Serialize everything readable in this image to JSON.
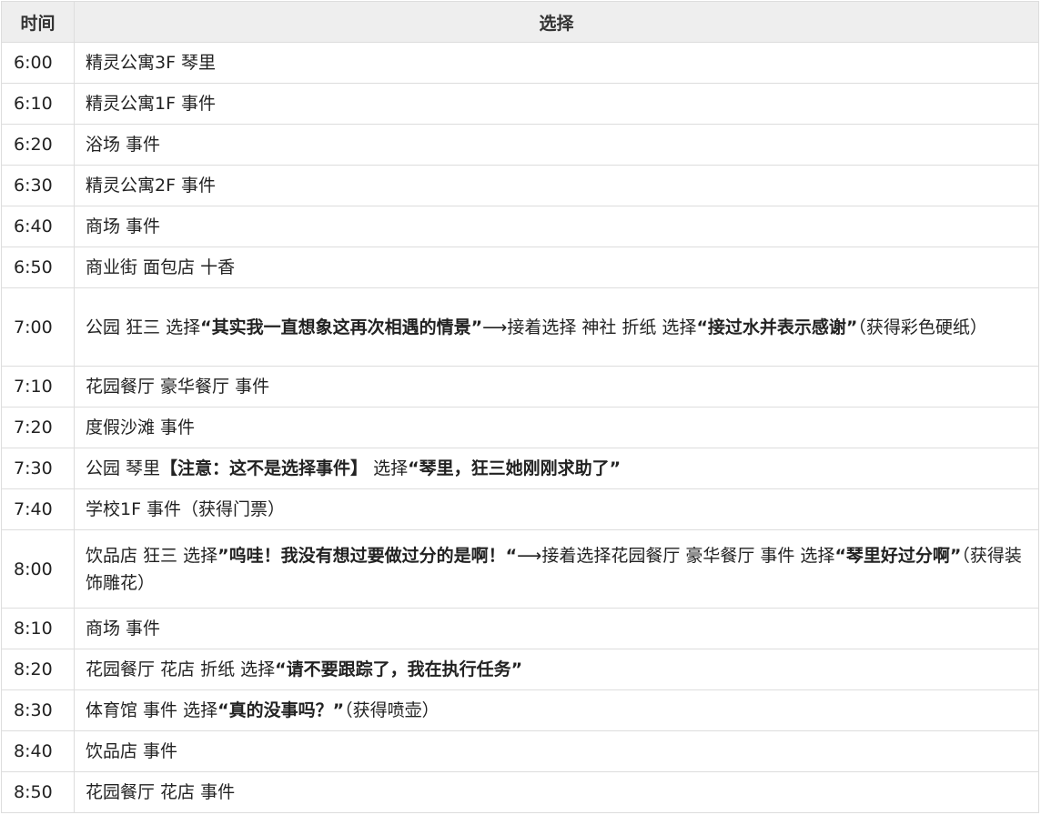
{
  "table": {
    "headers": [
      "时间",
      "选择"
    ],
    "rows": [
      {
        "time": "6:00",
        "segments": [
          {
            "t": "精灵公寓3F 琴里",
            "b": false
          }
        ]
      },
      {
        "time": "6:10",
        "segments": [
          {
            "t": "精灵公寓1F 事件",
            "b": false
          }
        ]
      },
      {
        "time": "6:20",
        "segments": [
          {
            "t": "浴场 事件",
            "b": false
          }
        ]
      },
      {
        "time": "6:30",
        "segments": [
          {
            "t": "精灵公寓2F 事件",
            "b": false
          }
        ]
      },
      {
        "time": "6:40",
        "segments": [
          {
            "t": "商场 事件",
            "b": false
          }
        ]
      },
      {
        "time": "6:50",
        "segments": [
          {
            "t": "商业街 面包店 十香",
            "b": false
          }
        ]
      },
      {
        "time": "7:00",
        "segments": [
          {
            "t": "公园 狂三 选择",
            "b": false
          },
          {
            "t": "“其实我一直想象这再次相遇的情景”",
            "b": true
          },
          {
            "t": "⟶接着选择 神社 折纸 选择",
            "b": false
          },
          {
            "t": "“接过水并表示感谢”",
            "b": true
          },
          {
            "t": "（获得彩色硬纸）",
            "b": false
          }
        ]
      },
      {
        "time": "7:10",
        "segments": [
          {
            "t": "花园餐厅 豪华餐厅 事件",
            "b": false
          }
        ]
      },
      {
        "time": "7:20",
        "segments": [
          {
            "t": "度假沙滩 事件",
            "b": false
          }
        ]
      },
      {
        "time": "7:30",
        "segments": [
          {
            "t": "公园 琴里",
            "b": false
          },
          {
            "t": "【注意：这不是选择事件】",
            "b": true
          },
          {
            "t": " 选择",
            "b": false
          },
          {
            "t": "“琴里，狂三她刚刚求助了”",
            "b": true
          }
        ]
      },
      {
        "time": "7:40",
        "segments": [
          {
            "t": "学校1F 事件（获得门票）",
            "b": false
          }
        ]
      },
      {
        "time": "8:00",
        "segments": [
          {
            "t": "饮品店 狂三 选择",
            "b": false
          },
          {
            "t": "”呜哇！我没有想过要做过分的是啊！“",
            "b": true
          },
          {
            "t": "⟶接着选择花园餐厅 豪华餐厅 事件 选择",
            "b": false
          },
          {
            "t": "“琴里好过分啊”",
            "b": true
          },
          {
            "t": "（获得装饰雕花）",
            "b": false
          }
        ]
      },
      {
        "time": "8:10",
        "segments": [
          {
            "t": "商场 事件",
            "b": false
          }
        ]
      },
      {
        "time": "8:20",
        "segments": [
          {
            "t": "花园餐厅 花店 折纸 选择",
            "b": false
          },
          {
            "t": "“请不要跟踪了，我在执行任务”",
            "b": true
          }
        ]
      },
      {
        "time": "8:30",
        "segments": [
          {
            "t": "体育馆 事件 选择",
            "b": false
          },
          {
            "t": "“真的没事吗？”",
            "b": true
          },
          {
            "t": "（获得喷壶）",
            "b": false
          }
        ]
      },
      {
        "time": "8:40",
        "segments": [
          {
            "t": "饮品店 事件",
            "b": false
          }
        ]
      },
      {
        "time": "8:50",
        "segments": [
          {
            "t": "花园餐厅 花店 事件",
            "b": false
          }
        ]
      }
    ]
  }
}
